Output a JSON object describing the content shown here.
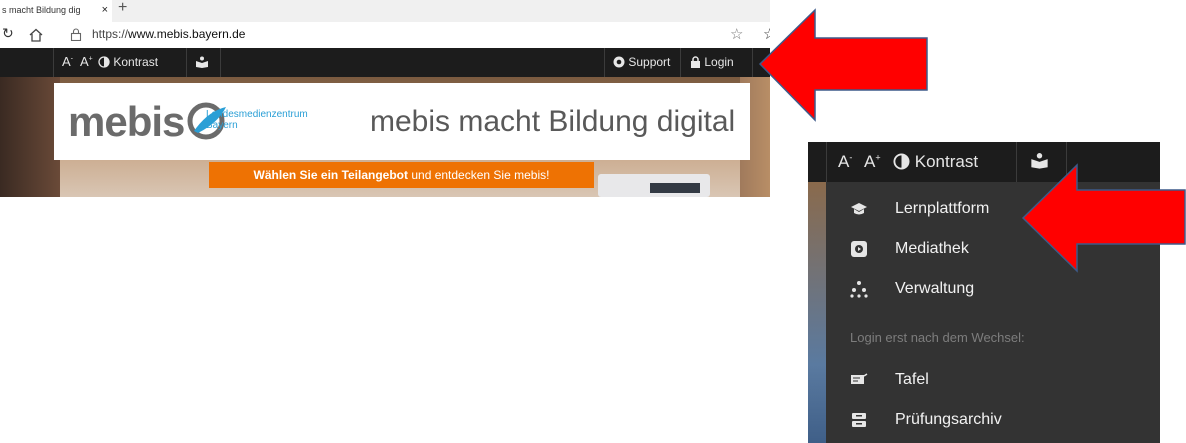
{
  "browser": {
    "tab_title": "s macht Bildung dig",
    "tab_close": "×",
    "new_tab": "+",
    "url_prefix": "https://",
    "url_host": "www.mebis.bayern.de"
  },
  "site_toolbar": {
    "font_decrease": "A",
    "font_increase": "A",
    "contrast_label": "Kontrast",
    "support_label": "Support",
    "login_label": "Login"
  },
  "banner": {
    "logo_word": "mebis",
    "logo_sub_line1": "Landesmedienzentrum",
    "logo_sub_line2": "Bayern",
    "tagline": "mebis macht Bildung digital",
    "cta_bold": "Wählen Sie ein Teilangebot",
    "cta_rest": " und entdecken Sie mebis!"
  },
  "login_menu": {
    "items": [
      {
        "label": "Lernplattform",
        "icon": "graduation-cap-icon"
      },
      {
        "label": "Mediathek",
        "icon": "media-play-icon"
      },
      {
        "label": "Verwaltung",
        "icon": "hierarchy-icon"
      }
    ],
    "note": "Login erst nach dem Wechsel:",
    "after_items": [
      {
        "label": "Tafel",
        "icon": "board-icon"
      },
      {
        "label": "Prüfungsarchiv",
        "icon": "archive-icon"
      }
    ]
  },
  "colors": {
    "toolbar_bg": "#1c1c1c",
    "menu_bg": "#333333",
    "accent_orange": "#ee7203",
    "logo_blue": "#2a9fd6",
    "arrow_red": "#ff0000"
  }
}
